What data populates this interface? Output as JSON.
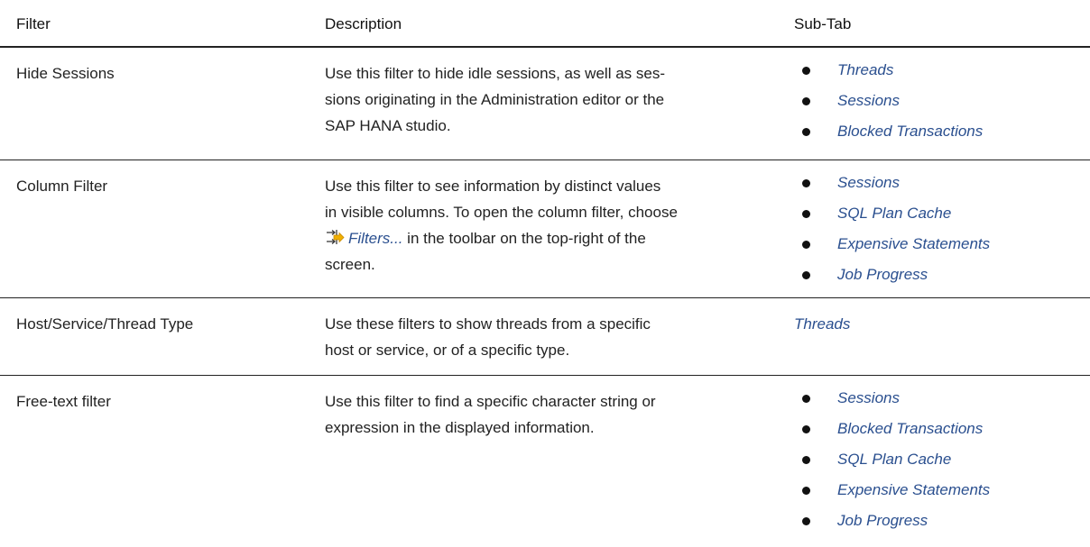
{
  "header": {
    "filter": "Filter",
    "description": "Description",
    "subtab": "Sub-Tab"
  },
  "rows": [
    {
      "filter": "Hide Sessions",
      "description_lines": [
        "Use this filter to hide idle sessions, as well as ses-",
        "sions originating in the Administration editor or the",
        "SAP HANA studio."
      ],
      "subtabs": [
        "Threads",
        "Sessions",
        "Blocked Transactions"
      ]
    },
    {
      "filter": "Column Filter",
      "description_lines": [
        "Use this filter to see information by distinct values",
        "in visible columns. To open the column filter, choose"
      ],
      "description_link": "Filters...",
      "description_after_link": " in the toolbar on the top-right of the",
      "description_last": "screen.",
      "icon": "filters-icon",
      "subtabs": [
        "Sessions",
        "SQL Plan Cache",
        "Expensive Statements",
        "Job Progress"
      ]
    },
    {
      "filter": "Host/Service/Thread Type",
      "description_lines": [
        "Use these filters to show threads from a specific",
        "host or service, or of a specific type."
      ],
      "subtab_plain": "Threads"
    },
    {
      "filter": "Free-text filter",
      "description_lines": [
        "Use this filter to find a specific character string or",
        "expression in the displayed information."
      ],
      "subtabs": [
        "Sessions",
        "Blocked Transactions",
        "SQL Plan Cache",
        "Expensive Statements",
        "Job Progress"
      ]
    }
  ]
}
